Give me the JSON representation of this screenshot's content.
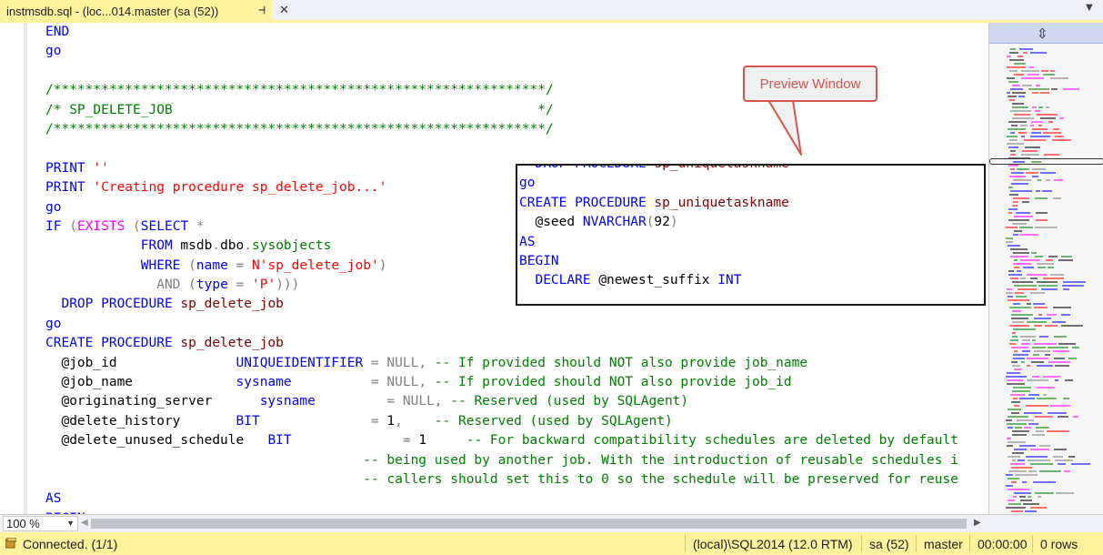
{
  "tab": {
    "title": "instmsdb.sql - (loc...014.master (sa (52))",
    "pin_glyph": "⊣",
    "close_glyph": "✕",
    "dropdown_glyph": "▼"
  },
  "code_lines": [
    [
      [
        "kw",
        "END"
      ]
    ],
    [
      [
        "kw",
        "go"
      ]
    ],
    [],
    [
      [
        "cm",
        "/**************************************************************/"
      ]
    ],
    [
      [
        "cm",
        "/* SP_DELETE_JOB                                              */"
      ]
    ],
    [
      [
        "cm",
        "/**************************************************************/"
      ]
    ],
    [],
    [
      [
        "kw",
        "PRINT "
      ],
      [
        "str",
        "''"
      ]
    ],
    [
      [
        "kw",
        "PRINT "
      ],
      [
        "str",
        "'Creating procedure sp_delete_job...'"
      ]
    ],
    [
      [
        "kw",
        "go"
      ]
    ],
    [
      [
        "kw",
        "IF "
      ],
      [
        "op",
        "("
      ],
      [
        "fn",
        "EXISTS"
      ],
      [
        "op",
        " ("
      ],
      [
        "kw",
        "SELECT "
      ],
      [
        "op",
        "*"
      ]
    ],
    [
      [
        "pl",
        "            "
      ],
      [
        "kw",
        "FROM "
      ],
      [
        "pl",
        "msdb"
      ],
      [
        "op",
        "."
      ],
      [
        "pl",
        "dbo"
      ],
      [
        "op",
        "."
      ],
      [
        "sys",
        "sysobjects"
      ]
    ],
    [
      [
        "pl",
        "            "
      ],
      [
        "kw",
        "WHERE "
      ],
      [
        "op",
        "("
      ],
      [
        "kw",
        "name "
      ],
      [
        "op",
        "= "
      ],
      [
        "str",
        "N'sp_delete_job'"
      ],
      [
        "op",
        ")"
      ]
    ],
    [
      [
        "pl",
        "              "
      ],
      [
        "op",
        "AND ("
      ],
      [
        "kw",
        "type "
      ],
      [
        "op",
        "= "
      ],
      [
        "str",
        "'P'"
      ],
      [
        "op",
        ")))"
      ]
    ],
    [
      [
        "pl",
        "  "
      ],
      [
        "kw",
        "DROP PROCEDURE "
      ],
      [
        "proc",
        "sp_delete_job"
      ]
    ],
    [
      [
        "kw",
        "go"
      ]
    ],
    [
      [
        "kw",
        "CREATE PROCEDURE "
      ],
      [
        "proc",
        "sp_delete_job"
      ]
    ],
    [
      [
        "pl",
        "  @job_id               "
      ],
      [
        "kw",
        "UNIQUEIDENTIFIER "
      ],
      [
        "op",
        "= "
      ],
      [
        "op",
        "NULL"
      ],
      [
        "op",
        ", "
      ],
      [
        "cm",
        "-- If provided should NOT also provide job_name"
      ]
    ],
    [
      [
        "pl",
        "  @job_name             "
      ],
      [
        "kw",
        "sysname"
      ],
      [
        "pl",
        "          "
      ],
      [
        "op",
        "= "
      ],
      [
        "op",
        "NULL"
      ],
      [
        "op",
        ", "
      ],
      [
        "cm",
        "-- If provided should NOT also provide job_id"
      ]
    ],
    [
      [
        "pl",
        "  @originating_server      "
      ],
      [
        "kw",
        "sysname"
      ],
      [
        "pl",
        "         "
      ],
      [
        "op",
        "= "
      ],
      [
        "op",
        "NULL"
      ],
      [
        "op",
        ", "
      ],
      [
        "cm",
        "-- Reserved (used by SQLAgent)"
      ]
    ],
    [
      [
        "pl",
        "  @delete_history       "
      ],
      [
        "kw",
        "BIT"
      ],
      [
        "pl",
        "              "
      ],
      [
        "op",
        "= "
      ],
      [
        "pl",
        "1"
      ],
      [
        "op",
        ",    "
      ],
      [
        "cm",
        "-- Reserved (used by SQLAgent)"
      ]
    ],
    [
      [
        "pl",
        "  @delete_unused_schedule   "
      ],
      [
        "kw",
        "BIT"
      ],
      [
        "pl",
        "              "
      ],
      [
        "op",
        "= "
      ],
      [
        "pl",
        "1     "
      ],
      [
        "cm",
        "-- For backward compatibility schedules are deleted by default"
      ]
    ],
    [
      [
        "pl",
        "                                        "
      ],
      [
        "cm",
        "-- being used by another job. With the introduction of reusable schedules i"
      ]
    ],
    [
      [
        "pl",
        "                                        "
      ],
      [
        "cm",
        "-- callers should set this to 0 so the schedule will be preserved for reuse"
      ]
    ],
    [
      [
        "kw",
        "AS"
      ]
    ],
    [
      [
        "kw",
        "BEGIN"
      ]
    ]
  ],
  "preview_lines": [
    [
      [
        "pl",
        "  "
      ],
      [
        "kw",
        "DROP PROCEDURE "
      ],
      [
        "proc",
        "sp_uniquetaskname"
      ]
    ],
    [
      [
        "kw",
        "go"
      ]
    ],
    [
      [
        "kw",
        "CREATE PROCEDURE "
      ],
      [
        "proc",
        "sp_uniquetaskname"
      ]
    ],
    [
      [
        "pl",
        "  @seed "
      ],
      [
        "kw",
        "NVARCHAR"
      ],
      [
        "op",
        "("
      ],
      [
        "pl",
        "92"
      ],
      [
        "op",
        ")"
      ]
    ],
    [
      [
        "kw",
        "AS"
      ]
    ],
    [
      [
        "kw",
        "BEGIN"
      ]
    ],
    [
      [
        "pl",
        "  "
      ],
      [
        "kw",
        "DECLARE "
      ],
      [
        "pl",
        "@newest_suffix "
      ],
      [
        "kw",
        "INT"
      ]
    ]
  ],
  "callout": {
    "label": "Preview Window"
  },
  "map": {
    "split_glyph": "⇳"
  },
  "zoom": {
    "value": "100 %",
    "arrow": "▼"
  },
  "scroll": {
    "left_glyph": "◀",
    "right_glyph": "▶"
  },
  "status": {
    "text": "Connected. (1/1)",
    "server": "(local)\\SQL2014 (12.0 RTM)",
    "user": "sa (52)",
    "database": "master",
    "elapsed": "00:00:00",
    "rows": "0 rows"
  },
  "colors": {
    "tab_active": "#fff29d",
    "keyword": "#0000ff",
    "string": "#ff0000",
    "comment": "#008000",
    "callout": "#d9534f"
  }
}
